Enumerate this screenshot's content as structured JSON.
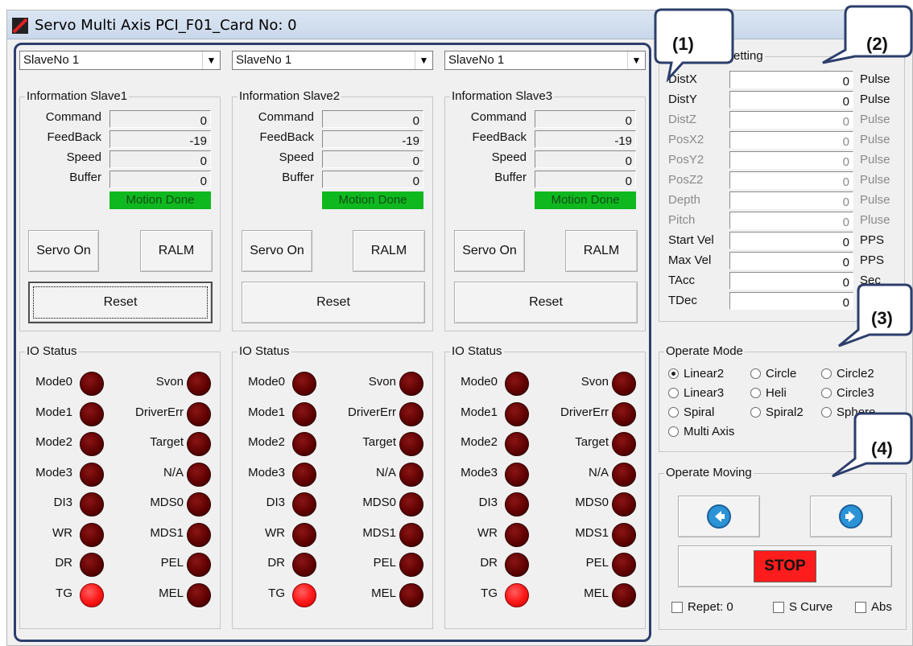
{
  "window": {
    "title": "Servo Multi Axis PCI_F01_Card No: 0"
  },
  "callouts": [
    "(1)",
    "(2)",
    "(3)",
    "(4)"
  ],
  "slaves": [
    {
      "combo_value": "SlaveNo 1",
      "info_title": "Information Slave1",
      "labels": {
        "command": "Command",
        "feedback": "FeedBack",
        "speed": "Speed",
        "buffer": "Buffer"
      },
      "values": {
        "command": "0",
        "feedback": "-19",
        "speed": "0",
        "buffer": "0"
      },
      "status": "Motion Done",
      "servo_on": "Servo On",
      "ralm": "RALM",
      "reset": "Reset",
      "io_title": "IO Status"
    },
    {
      "combo_value": "SlaveNo 1",
      "info_title": "Information Slave2",
      "labels": {
        "command": "Command",
        "feedback": "FeedBack",
        "speed": "Speed",
        "buffer": "Buffer"
      },
      "values": {
        "command": "0",
        "feedback": "-19",
        "speed": "0",
        "buffer": "0"
      },
      "status": "Motion Done",
      "servo_on": "Servo On",
      "ralm": "RALM",
      "reset": "Reset",
      "io_title": "IO Status"
    },
    {
      "combo_value": "SlaveNo 1",
      "info_title": "Information Slave3",
      "labels": {
        "command": "Command",
        "feedback": "FeedBack",
        "speed": "Speed",
        "buffer": "Buffer"
      },
      "values": {
        "command": "0",
        "feedback": "-19",
        "speed": "0",
        "buffer": "0"
      },
      "status": "Motion Done",
      "servo_on": "Servo On",
      "ralm": "RALM",
      "reset": "Reset",
      "io_title": "IO Status"
    }
  ],
  "io_left": [
    "Mode0",
    "Mode1",
    "Mode2",
    "Mode3",
    "DI3",
    "WR",
    "DR",
    "TG"
  ],
  "io_right": [
    "Svon",
    "DriverErr",
    "Target",
    "N/A",
    "MDS0",
    "MDS1",
    "PEL",
    "MEL"
  ],
  "io_left_on": [
    false,
    false,
    false,
    false,
    false,
    false,
    false,
    true
  ],
  "io_right_on": [
    false,
    false,
    false,
    false,
    false,
    false,
    false,
    false
  ],
  "setting": {
    "title": "Setting",
    "rows": [
      {
        "label": "DistX",
        "value": "0",
        "unit": "Pulse",
        "enabled": true
      },
      {
        "label": "DistY",
        "value": "0",
        "unit": "Pulse",
        "enabled": true
      },
      {
        "label": "DistZ",
        "value": "0",
        "unit": "Pulse",
        "enabled": false
      },
      {
        "label": "PosX2",
        "value": "0",
        "unit": "Pulse",
        "enabled": false
      },
      {
        "label": "PosY2",
        "value": "0",
        "unit": "Pulse",
        "enabled": false
      },
      {
        "label": "PosZ2",
        "value": "0",
        "unit": "Pulse",
        "enabled": false
      },
      {
        "label": "Depth",
        "value": "0",
        "unit": "Pulse",
        "enabled": false
      },
      {
        "label": "Pitch",
        "value": "0",
        "unit": "Pluse",
        "enabled": false
      },
      {
        "label": "Start Vel",
        "value": "0",
        "unit": "PPS",
        "enabled": true
      },
      {
        "label": "Max Vel",
        "value": "0",
        "unit": "PPS",
        "enabled": true
      },
      {
        "label": "TAcc",
        "value": "0",
        "unit": "Sec",
        "enabled": true
      },
      {
        "label": "TDec",
        "value": "0",
        "unit": "",
        "enabled": true
      }
    ]
  },
  "operate_mode": {
    "title": "Operate Mode",
    "options": [
      "Linear2",
      "Circle",
      "Circle2",
      "Linear3",
      "Heli",
      "Circle3",
      "Spiral",
      "Spiral2",
      "Sphere",
      "Multi Axis"
    ],
    "selected": "Linear2"
  },
  "operate_moving": {
    "title": "Operate Moving",
    "stop": "STOP",
    "repeat": "Repet: 0",
    "s_curve": "S Curve",
    "abs": "Abs"
  }
}
